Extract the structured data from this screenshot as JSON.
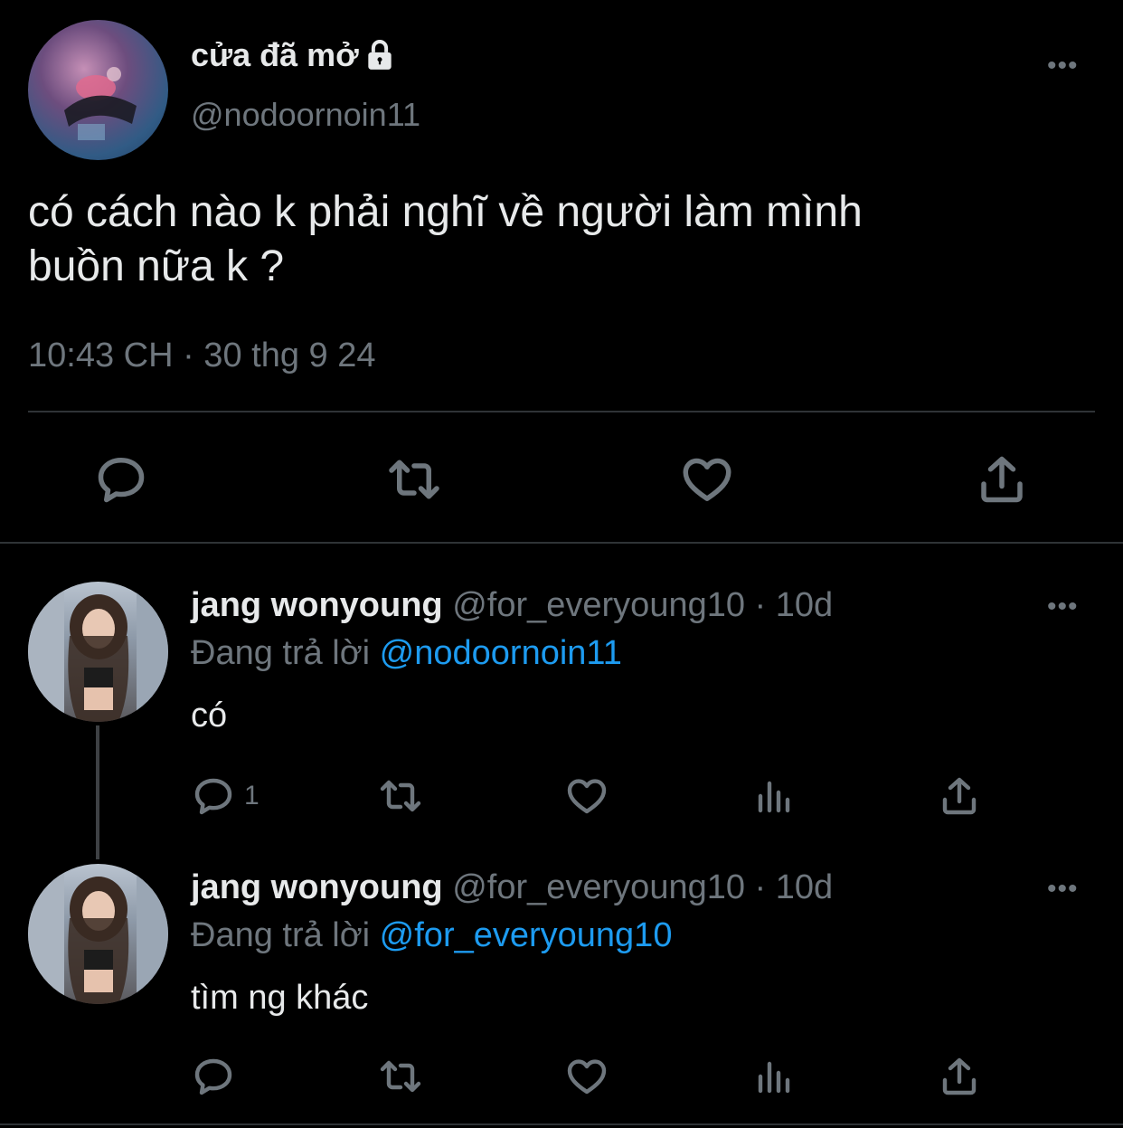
{
  "main_tweet": {
    "display_name": "cửa đã mở",
    "handle": "@nodoornoin11",
    "text_line1": "có cách nào k phải nghĩ về người làm mình",
    "text_line2": "buồn nữa k ?",
    "timestamp": "10:43 CH · 30 thg 9 24",
    "avatar_icon": "snorkel-photo-avatar",
    "verified_icon": "lock-icon"
  },
  "replies": [
    {
      "display_name": "jang wonyoung",
      "handle_time": "@for_everyoung10 · 10d",
      "replying_prefix": "Đang trả lời",
      "replying_to": "@nodoornoin11",
      "text": "có",
      "reply_count": "1"
    },
    {
      "display_name": "jang wonyoung",
      "handle_time": "@for_everyoung10 · 10d",
      "replying_prefix": "Đang trả lời",
      "replying_to": "@for_everyoung10",
      "text": "tìm ng khác",
      "reply_count": ""
    }
  ],
  "colors": {
    "background": "#000000",
    "text": "#e7e9ea",
    "muted": "#6e767d",
    "link": "#1d9bf0",
    "divider": "#2f3336"
  }
}
